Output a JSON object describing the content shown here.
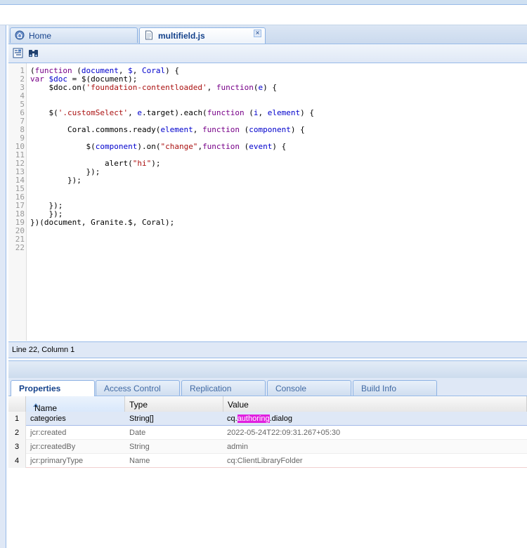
{
  "editor_tabs": [
    {
      "label": "Home",
      "icon": "home-icon",
      "active": false,
      "closable": false
    },
    {
      "label": "multifield.js",
      "icon": "file-icon",
      "active": true,
      "closable": true
    }
  ],
  "toolbar": {
    "buttons": [
      {
        "icon": "outline-icon"
      },
      {
        "icon": "find-binoculars-icon"
      }
    ]
  },
  "code": {
    "line_numbers": [
      "1",
      "2",
      "3",
      "4",
      "5",
      "6",
      "7",
      "8",
      "9",
      "10",
      "11",
      "12",
      "13",
      "14",
      "15",
      "16",
      "17",
      "18",
      "19",
      "20",
      "21",
      "22"
    ]
  },
  "status": {
    "text": "Line 22, Column 1"
  },
  "bottom_tabs": [
    {
      "label": "Properties",
      "active": true
    },
    {
      "label": "Access Control",
      "active": false
    },
    {
      "label": "Replication",
      "active": false
    },
    {
      "label": "Console",
      "active": false
    },
    {
      "label": "Build Info",
      "active": false
    }
  ],
  "properties": {
    "columns": [
      "Name",
      "Type",
      "Value"
    ],
    "sorted_column": "Name",
    "rows": [
      {
        "num": "1",
        "name": "categories",
        "type": "String[]",
        "value_pre": "cq.",
        "value_hl": "authoring",
        "value_post": ".dialog",
        "selected": true
      },
      {
        "num": "2",
        "name": "jcr:created",
        "type": "Date",
        "value": "2022-05-24T22:09:31.267+05:30"
      },
      {
        "num": "3",
        "name": "jcr:createdBy",
        "type": "String",
        "value": "admin"
      },
      {
        "num": "4",
        "name": "jcr:primaryType",
        "type": "Name",
        "value": "cq:ClientLibraryFolder"
      }
    ]
  },
  "colors": {
    "accent": "#15428b",
    "highlight": "#e020e0",
    "panel": "#dfe8f6"
  }
}
